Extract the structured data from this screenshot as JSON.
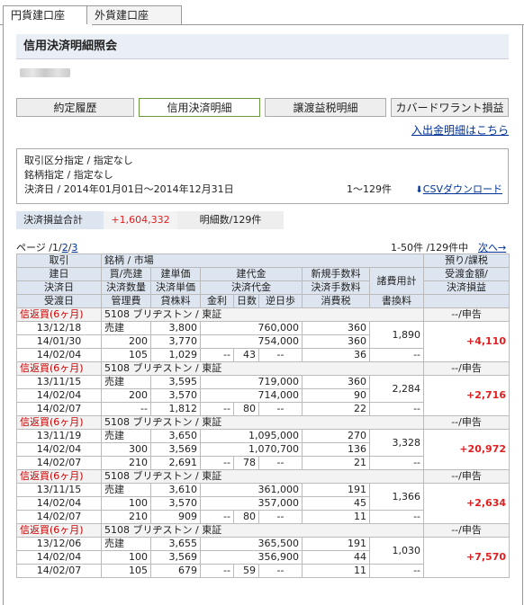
{
  "tabs": [
    {
      "label": "円貨建口座"
    },
    {
      "label": "外貨建口座"
    }
  ],
  "title": "信用決済明細照会",
  "nav_buttons": [
    {
      "label": "約定履歴"
    },
    {
      "label": "信用決済明細"
    },
    {
      "label": "譲渡益税明細"
    },
    {
      "label": "カバードワラント損益"
    }
  ],
  "deposit_link": "入出金明細はこちら",
  "conditions": {
    "line1": "取引区分指定 / 指定なし",
    "line2": "銘柄指定 / 指定なし",
    "line3": "決済日 / 2014年01月01日〜2014年12月31日",
    "range": "1〜129件",
    "download_icon": "download-arrow-icon",
    "download": "CSVダウンロード"
  },
  "summary": {
    "pl_label": "決済損益合計",
    "pl_value": "+1,604,332",
    "count": "明細数/129件"
  },
  "pager": {
    "prefix": "ページ /",
    "p1": "1",
    "sep1": "/",
    "p2": "2",
    "sep2": "/",
    "p3": "3",
    "status": "1-50件 /129件中",
    "next": "次へ→"
  },
  "headers": {
    "r1": [
      "取引",
      "銘柄 / 市場",
      "預り/課税"
    ],
    "r2": [
      "建日",
      "買/売建",
      "建単価",
      "建代金",
      "新規手数料",
      "諸費用計",
      "受渡金額/"
    ],
    "r3": [
      "決済日",
      "決済数量",
      "決済単価",
      "決済代金",
      "決済手数料",
      "決済損益"
    ],
    "r4": [
      "受渡日",
      "管理費",
      "貸株料",
      "金利",
      "日数",
      "逆日歩",
      "消費税",
      "書換料"
    ]
  },
  "groups": [
    {
      "kind": "信返買(6ヶ月)",
      "issue": "5108 ブリヂストン / 東証",
      "tax": "--/申告",
      "build_date": "13/12/18",
      "side": "売建",
      "build_price": "3,800",
      "build_amount": "760,000",
      "new_fee": "360",
      "expenses": "1,890",
      "settle_date": "14/01/30",
      "qty": "200",
      "settle_price": "3,770",
      "settle_amount": "754,000",
      "settle_fee": "360",
      "pl": "+4,110",
      "delivery_date": "14/02/04",
      "mgmt_fee": "105",
      "lend_fee": "1,029",
      "interest": "--",
      "days": "43",
      "reverse": "--",
      "tax_amt": "36",
      "rewrite": "--"
    },
    {
      "kind": "信返買(6ヶ月)",
      "issue": "5108 ブリヂストン / 東証",
      "tax": "--/申告",
      "build_date": "13/11/15",
      "side": "売建",
      "build_price": "3,595",
      "build_amount": "719,000",
      "new_fee": "360",
      "expenses": "2,284",
      "settle_date": "14/02/04",
      "qty": "200",
      "settle_price": "3,570",
      "settle_amount": "714,000",
      "settle_fee": "90",
      "pl": "+2,716",
      "delivery_date": "14/02/07",
      "mgmt_fee": "--",
      "lend_fee": "1,812",
      "interest": "--",
      "days": "80",
      "reverse": "--",
      "tax_amt": "22",
      "rewrite": "--"
    },
    {
      "kind": "信返買(6ヶ月)",
      "issue": "5108 ブリヂストン / 東証",
      "tax": "--/申告",
      "build_date": "13/11/19",
      "side": "売建",
      "build_price": "3,650",
      "build_amount": "1,095,000",
      "new_fee": "270",
      "expenses": "3,328",
      "settle_date": "14/02/04",
      "qty": "300",
      "settle_price": "3,569",
      "settle_amount": "1,070,700",
      "settle_fee": "136",
      "pl": "+20,972",
      "delivery_date": "14/02/07",
      "mgmt_fee": "210",
      "lend_fee": "2,691",
      "interest": "--",
      "days": "78",
      "reverse": "--",
      "tax_amt": "21",
      "rewrite": "--"
    },
    {
      "kind": "信返買(6ヶ月)",
      "issue": "5108 ブリヂストン / 東証",
      "tax": "--/申告",
      "build_date": "13/11/15",
      "side": "売建",
      "build_price": "3,610",
      "build_amount": "361,000",
      "new_fee": "191",
      "expenses": "1,366",
      "settle_date": "14/02/04",
      "qty": "100",
      "settle_price": "3,570",
      "settle_amount": "357,000",
      "settle_fee": "45",
      "pl": "+2,634",
      "delivery_date": "14/02/07",
      "mgmt_fee": "210",
      "lend_fee": "909",
      "interest": "--",
      "days": "80",
      "reverse": "--",
      "tax_amt": "11",
      "rewrite": "--"
    },
    {
      "kind": "信返買(6ヶ月)",
      "issue": "5108 ブリヂストン / 東証",
      "tax": "--/申告",
      "build_date": "13/12/06",
      "side": "売建",
      "build_price": "3,655",
      "build_amount": "365,500",
      "new_fee": "191",
      "expenses": "1,030",
      "settle_date": "14/02/04",
      "qty": "100",
      "settle_price": "3,569",
      "settle_amount": "356,900",
      "settle_fee": "44",
      "pl": "+7,570",
      "delivery_date": "14/02/07",
      "mgmt_fee": "105",
      "lend_fee": "679",
      "interest": "--",
      "days": "59",
      "reverse": "--",
      "tax_amt": "11",
      "rewrite": "--"
    }
  ]
}
